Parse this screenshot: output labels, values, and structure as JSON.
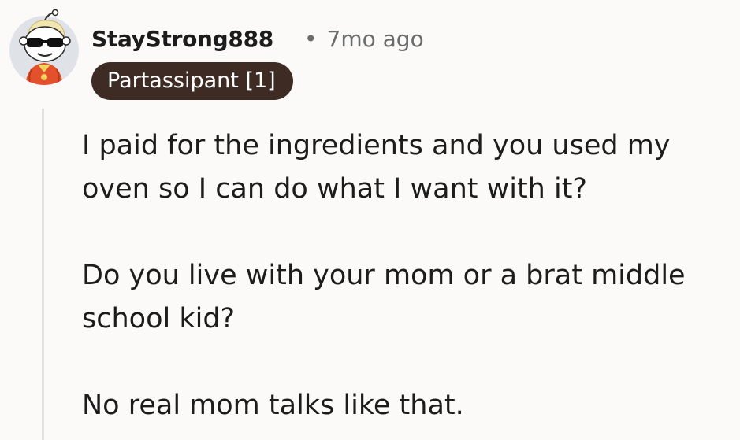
{
  "comment": {
    "username": "StayStrong888",
    "separator": "•",
    "timestamp": "7mo ago",
    "flair": "Partassipant [1]",
    "avatar_icon": "snoo-avatar-icon",
    "paragraphs": [
      "I paid for the ingredients and you used my oven so I can do what I want with it?",
      "Do you live with your mom or a brat middle school kid?",
      "No real mom talks like that."
    ]
  },
  "colors": {
    "background": "#fbfaf9",
    "flair_background": "#3d2b24",
    "flair_text": "#ffffff",
    "thread_line": "#e4e2df",
    "meta_text": "#6a6c6e"
  }
}
